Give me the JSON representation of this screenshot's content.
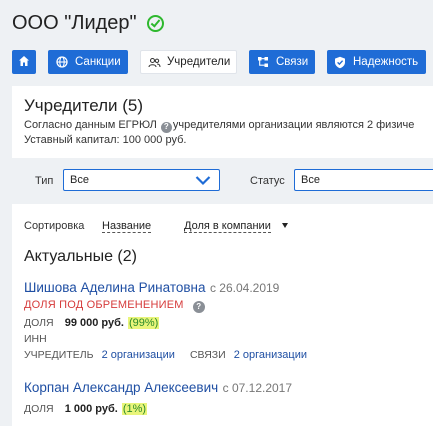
{
  "company": {
    "name": "ООО \"Лидер\""
  },
  "nav": {
    "items": [
      {
        "label": "",
        "icon": "home-icon"
      },
      {
        "label": "Санкции",
        "icon": "globe-icon"
      },
      {
        "label": "Учредители",
        "icon": "people-icon",
        "active": true
      },
      {
        "label": "Связи",
        "icon": "network-icon"
      },
      {
        "label": "Надежность",
        "icon": "shield-check-icon"
      }
    ]
  },
  "founders": {
    "title": "Учредители (5)",
    "desc_part1": "Согласно данным ЕГРЮЛ",
    "desc_part2": "учредителями организации являются 2 физиче",
    "capital": "Уставный капитал: 100 000 руб."
  },
  "filters": {
    "type_label": "Тип",
    "type_value": "Все",
    "status_label": "Статус",
    "status_value": "Все"
  },
  "sort": {
    "label": "Сортировка",
    "by_name": "Название",
    "by_share": "Доля в компании"
  },
  "current": {
    "title": "Актуальные (2)",
    "people": [
      {
        "name": "Шишова Аделина Ринатовна",
        "since": "с 26.04.2019",
        "encumbrance": "ДОЛЯ ПОД ОБРЕМЕНЕНИЕМ",
        "share_label": "ДОЛЯ",
        "share_value": "99 000 руб.",
        "share_pct": "(99%)",
        "inn_label": "ИНН",
        "founder_label": "УЧРЕДИТЕЛЬ",
        "founder_link": "2 организации",
        "links_label": "СВЯЗИ",
        "links_link": "2 организации"
      },
      {
        "name": "Корпан Александр Алексеевич",
        "since": "с 07.12.2017",
        "share_label": "ДОЛЯ",
        "share_value": "1 000 руб.",
        "share_pct": "(1%)"
      }
    ]
  },
  "colors": {
    "accent": "#1f6cd6",
    "link": "#1f4fa3",
    "success": "#2eb82e",
    "danger": "#d63b3b",
    "highlight": "#e9f57a",
    "background": "#eef1f4"
  }
}
